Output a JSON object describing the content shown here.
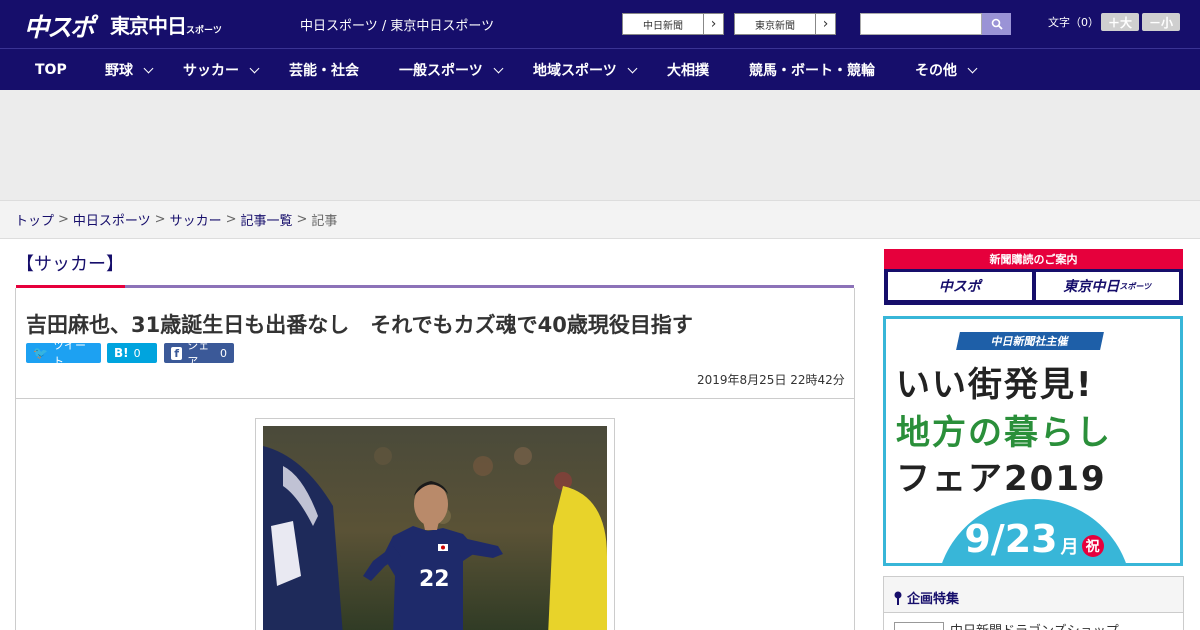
{
  "header": {
    "logo_chuspo": "中スポ",
    "logo_tokyo": "東京中日",
    "logo_tokyo_small": "スポーツ",
    "tagline": "中日スポーツ / 東京中日スポーツ",
    "ext_links": [
      {
        "label": "中日新聞",
        "arrow": "›"
      },
      {
        "label": "東京新聞",
        "arrow": "›"
      }
    ],
    "search_placeholder": "",
    "font_size_label": "文字（0）",
    "font_up_label": "＋大",
    "font_down_label": "－小"
  },
  "nav": {
    "items": [
      {
        "label": "TOP"
      },
      {
        "label": "野球"
      },
      {
        "label": "サッカー"
      },
      {
        "label": "芸能・社会"
      },
      {
        "label": "一般スポーツ"
      },
      {
        "label": "地域スポーツ"
      },
      {
        "label": "大相撲"
      },
      {
        "label": "競馬・ボート・競輪"
      },
      {
        "label": "その他"
      }
    ]
  },
  "breadcrumb": {
    "items": [
      "トップ",
      "中日スポーツ",
      "サッカー",
      "記事一覧"
    ],
    "separator": ">",
    "current": "記事"
  },
  "article": {
    "category": "【サッカー】",
    "title": "吉田麻也、31歳誕生日も出番なし　それでもカズ魂で40歳現役目指す",
    "share": {
      "tweet_icon": "🐦",
      "tweet_label": "ツイート",
      "hatena_icon": "B!",
      "hatena_count": "0",
      "facebook_icon": "f",
      "facebook_label": "シェア",
      "facebook_count": "0"
    },
    "date": "2019年8月25日 22時42分",
    "photo_jersey_number": "22"
  },
  "sidebar": {
    "subscription_title": "新聞購読のご案内",
    "subscription_chuspo": "中スポ",
    "subscription_tokyo": "東京中日",
    "subscription_tokyo_small": "スポーツ",
    "fair": {
      "sponsor": "中日新聞社主催",
      "line1": "いい街発見!",
      "line2": "地方の暮らし",
      "line3": "フェア2019",
      "date": "9/23",
      "day": "月",
      "holiday": "祝"
    },
    "feature_title": "企画特集",
    "feature_item": "中日新聞ドラゴンズショップ"
  },
  "colors": {
    "brand_navy": "#160e6b",
    "accent_red": "#e6003c",
    "accent_purple": "#8c72b8",
    "twitter_blue": "#1da1f2",
    "hatena_blue": "#00a4de",
    "facebook_blue": "#3b5998",
    "fair_cyan": "#38b6d8"
  }
}
